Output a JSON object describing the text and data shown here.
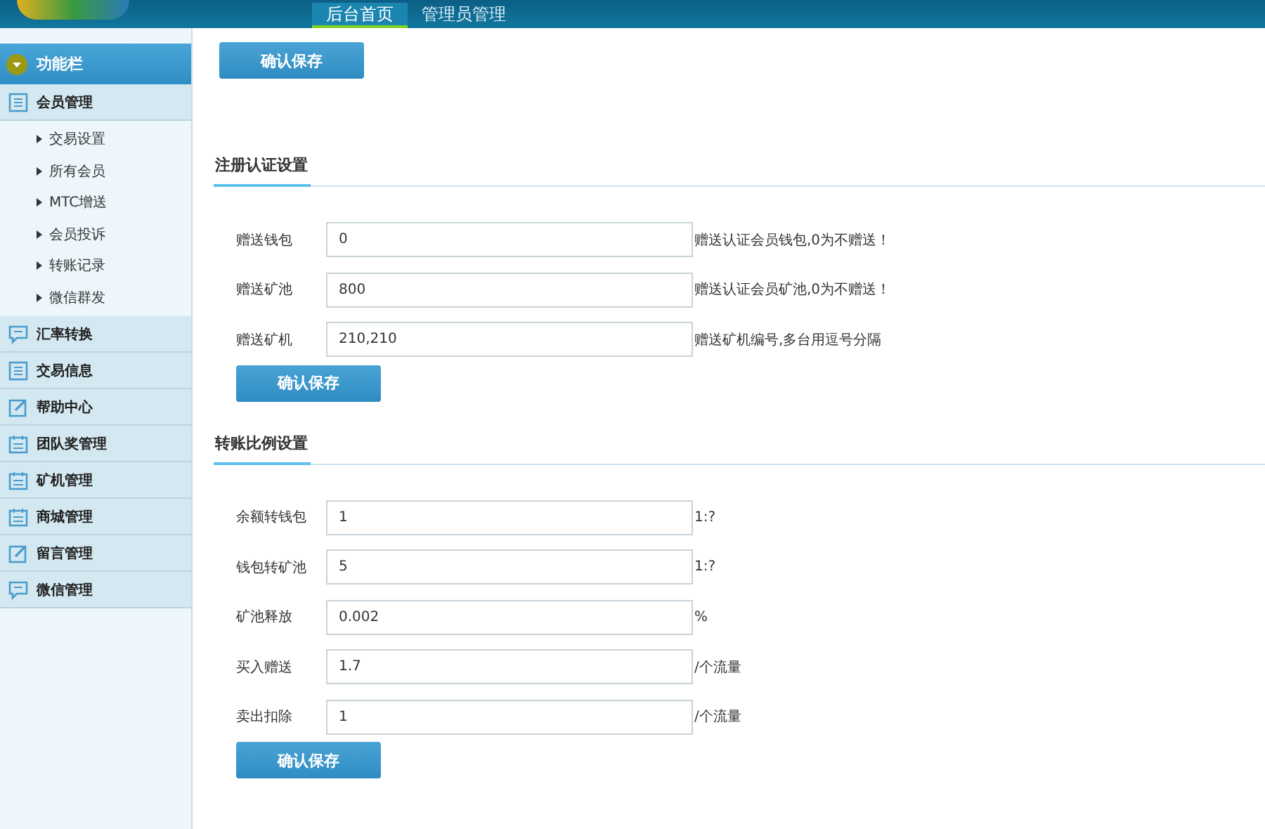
{
  "header": {
    "tabs": [
      {
        "label": "后台首页",
        "selected": true
      },
      {
        "label": "管理员管理",
        "selected": false
      }
    ]
  },
  "sidebar": {
    "title": "功能栏",
    "items": [
      {
        "label": "会员管理",
        "kind": "list",
        "children": [
          {
            "label": "交易设置"
          },
          {
            "label": "所有会员"
          },
          {
            "label": "MTC增送"
          },
          {
            "label": "会员投诉"
          },
          {
            "label": "转账记录"
          },
          {
            "label": "微信群发"
          }
        ]
      },
      {
        "label": "汇率转换",
        "kind": "chat"
      },
      {
        "label": "交易信息",
        "kind": "list"
      },
      {
        "label": "帮助中心",
        "kind": "edit"
      },
      {
        "label": "团队奖管理",
        "kind": "calendar"
      },
      {
        "label": "矿机管理",
        "kind": "calendar"
      },
      {
        "label": "商城管理",
        "kind": "calendar"
      },
      {
        "label": "留言管理",
        "kind": "edit"
      },
      {
        "label": "微信管理",
        "kind": "chat"
      }
    ]
  },
  "top_button": "确认保存",
  "sections": [
    {
      "title": "注册认证设置",
      "fields": [
        {
          "label": "赠送钱包",
          "value": "0",
          "hint": "赠送认证会员钱包,0为不赠送！"
        },
        {
          "label": "赠送矿池",
          "value": "800",
          "hint": "赠送认证会员矿池,0为不赠送！"
        },
        {
          "label": "赠送矿机",
          "value": "210,210",
          "hint": "赠送矿机编号,多台用逗号分隔"
        }
      ],
      "button": "确认保存"
    },
    {
      "title": "转账比例设置",
      "fields": [
        {
          "label": "余额转钱包",
          "value": "1",
          "hint": "1:?"
        },
        {
          "label": "钱包转矿池",
          "value": "5",
          "hint": "1:?"
        },
        {
          "label": "矿池释放",
          "value": "0.002",
          "hint": "%"
        },
        {
          "label": "买入赠送",
          "value": "1.7",
          "hint": "/个流量"
        },
        {
          "label": "卖出扣除",
          "value": "1",
          "hint": "/个流量"
        }
      ],
      "button": "确认保存"
    }
  ]
}
